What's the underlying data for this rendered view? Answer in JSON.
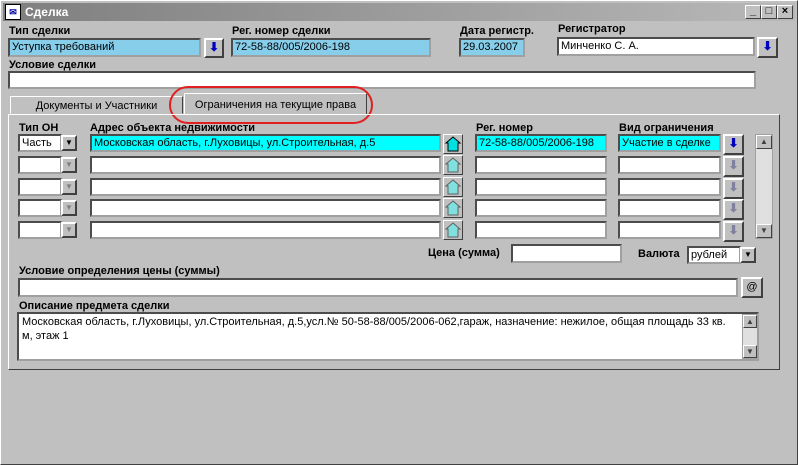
{
  "window": {
    "title": "Сделка",
    "app_icon": "document-icon"
  },
  "header": {
    "deal_type": {
      "label": "Тип сделки",
      "value": "Уступка требований"
    },
    "reg_number": {
      "label": "Рег. номер сделки",
      "value": "72-58-88/005/2006-198"
    },
    "reg_date": {
      "label": "Дата регистр.",
      "value": "29.03.2007"
    },
    "registrar": {
      "label": "Регистратор",
      "value": "Минченко С. А."
    },
    "deal_condition": {
      "label": "Условие сделки",
      "value": ""
    }
  },
  "tabs": [
    {
      "label": "Документы и Участники",
      "active": false
    },
    {
      "label": "Ограничения на текущие права",
      "active": true
    }
  ],
  "restrictions": {
    "col_type": "Тип ОН",
    "col_address": "Адрес объекта недвижимости",
    "col_reg": "Рег. номер",
    "col_kind": "Вид ограничения",
    "rows": [
      {
        "type": "Часть",
        "address": "Московская область, г.Луховицы, ул.Строительная, д.5",
        "reg": "72-58-88/005/2006-198",
        "kind": "Участие в сделке"
      },
      {
        "type": "",
        "address": "",
        "reg": "",
        "kind": ""
      },
      {
        "type": "",
        "address": "",
        "reg": "",
        "kind": ""
      },
      {
        "type": "",
        "address": "",
        "reg": "",
        "kind": ""
      },
      {
        "type": "",
        "address": "",
        "reg": "",
        "kind": ""
      }
    ]
  },
  "price": {
    "label": "Цена (сумма)",
    "value": ""
  },
  "currency": {
    "label": "Валюта",
    "value": "рублей"
  },
  "price_condition": {
    "label": "Условие определения цены (суммы)",
    "value": "",
    "button": "@"
  },
  "subject": {
    "label": "Описание предмета сделки",
    "value": "Московская область, г.Луховицы, ул.Строительная, д.5,усл.№ 50-58-88/005/2006-062,гараж, назначение: нежилое, общая площадь 33 кв. м, этаж 1"
  },
  "colors": {
    "highlight": "#87ceeb",
    "cyan": "#00ffff",
    "annotation": "#e02020"
  }
}
